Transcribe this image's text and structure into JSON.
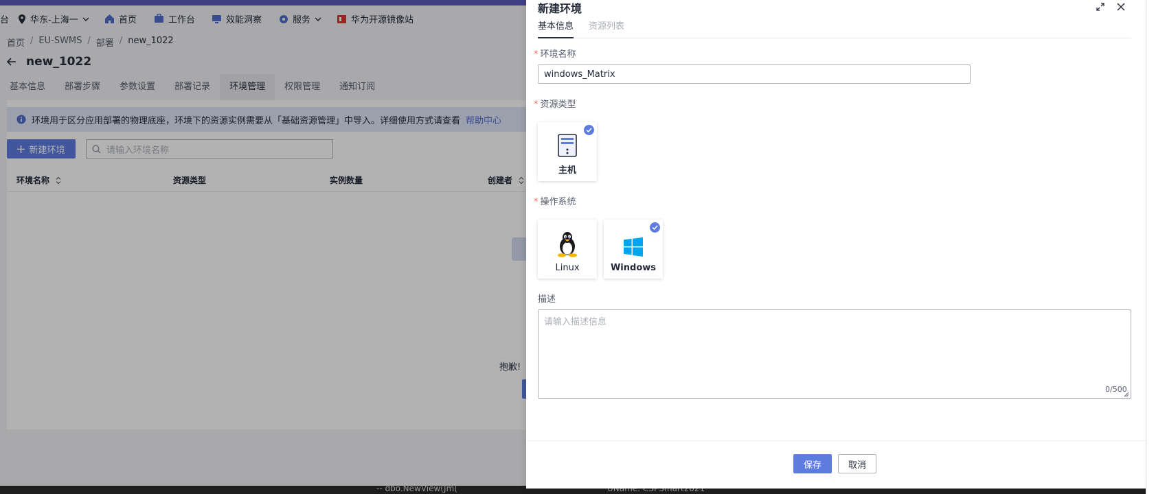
{
  "topnav": {
    "left_glyph": "台",
    "region": "华东-上海一",
    "home": "首页",
    "workbench": "工作台",
    "insight": "效能洞察",
    "service": "服务",
    "mirror": "华为开源镜像站"
  },
  "breadcrumb": {
    "items": [
      "首页",
      "EU-SWMS",
      "部署",
      "new_1022"
    ],
    "separator": "/"
  },
  "page": {
    "title": "new_1022",
    "tabs": [
      "基本信息",
      "部署步骤",
      "参数设置",
      "部署记录",
      "环境管理",
      "权限管理",
      "通知订阅"
    ],
    "active_tab": "环境管理",
    "info_text": "环境用于区分应用部署的物理底座，环境下的资源实例需要从「基础资源管理」中导入。详细使用方式请查看",
    "info_link": "帮助中心",
    "new_env_button": "新建环境",
    "search_placeholder": "请输入环境名称",
    "table_headers": [
      "环境名称",
      "资源类型",
      "实例数量",
      "创建者"
    ],
    "empty_text": "抱歉!"
  },
  "taskbar": {
    "left_text": "-- dbo.NewView(Jm(",
    "right_text": "UName: CSPSmart2021"
  },
  "drawer": {
    "title": "新建环境",
    "tabs": [
      "基本信息",
      "资源列表"
    ],
    "active_tab": "基本信息",
    "required_mark": "*",
    "env_name_label": "环境名称",
    "env_name_value": "windows_Matrix",
    "resource_type_label": "资源类型",
    "resource_type_option": "主机",
    "os_label": "操作系统",
    "os_options": [
      "Linux",
      "Windows"
    ],
    "os_selected": "Windows",
    "desc_label": "描述",
    "desc_placeholder": "请输入描述信息",
    "char_count": "0/500",
    "save_button": "保存",
    "cancel_button": "取消"
  },
  "colors": {
    "primary": "#5e7ce0",
    "nav_strip": "#5e5bbd",
    "required": "#f66f6a",
    "windows_blue": "#00a4ef",
    "info_bg": "#dfe5f7"
  },
  "icons": {
    "region": "location-pin-icon",
    "home": "home-icon",
    "workbench": "workbench-icon",
    "insight": "monitor-icon",
    "service": "service-icon",
    "mirror": "mirror-logo-icon",
    "back": "arrow-left-icon",
    "info": "info-icon",
    "add": "plus-icon",
    "search": "search-icon",
    "sort": "sort-icon",
    "expand": "expand-icon",
    "close": "close-icon",
    "host": "server-icon",
    "linux": "linux-penguin-icon",
    "windows": "windows-logo-icon",
    "check": "check-circle-icon"
  }
}
